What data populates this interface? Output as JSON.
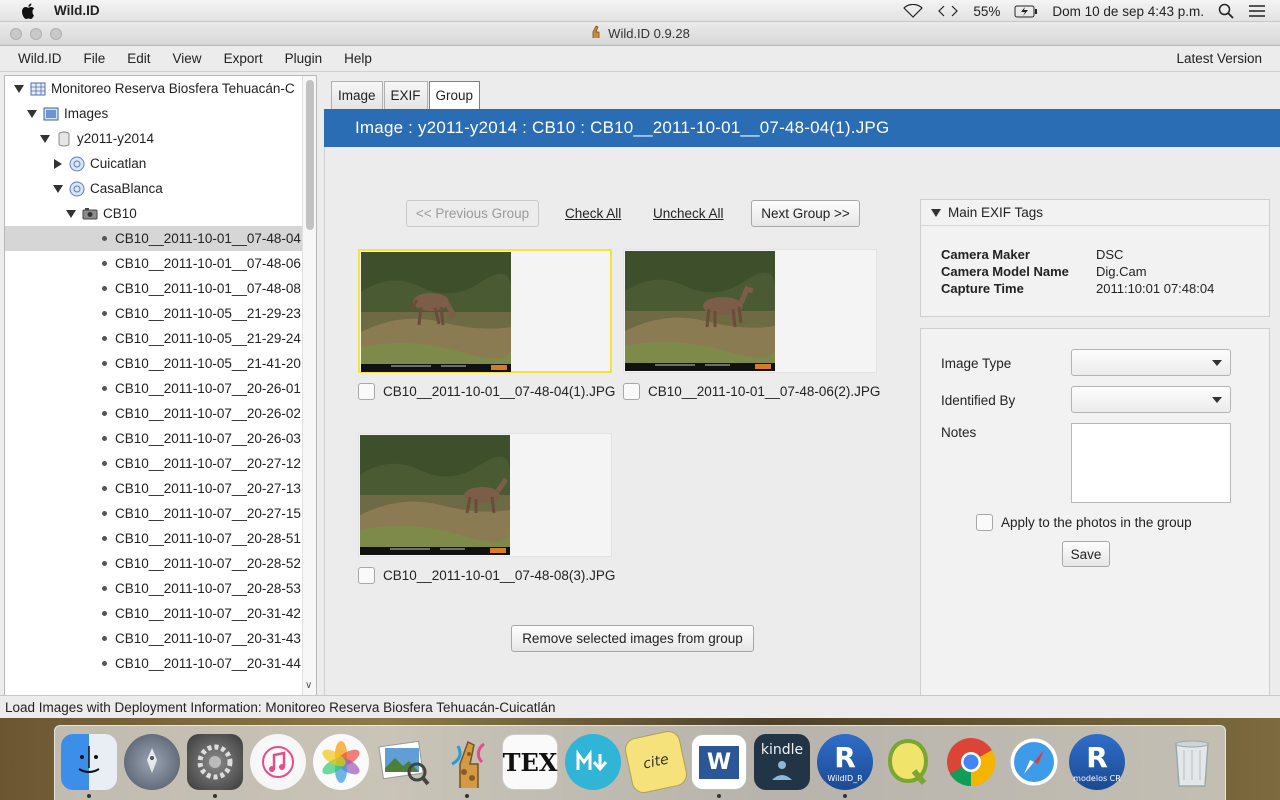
{
  "mac_menubar": {
    "app_name": "Wild.ID",
    "battery": "55%",
    "datetime": "Dom 10 de sep  4:43 p.m."
  },
  "window": {
    "title": "Wild.ID 0.9.28"
  },
  "menu": {
    "items": [
      "Wild.ID",
      "File",
      "Edit",
      "View",
      "Export",
      "Plugin",
      "Help"
    ],
    "latest_version": "Latest Version"
  },
  "tree": {
    "root": "Monitoreo Reserva Biosfera Tehuacán-C",
    "images": "Images",
    "period": "y2011-y2014",
    "site1": "Cuicatlan",
    "site2": "CasaBlanca",
    "camera": "CB10",
    "files": [
      "CB10__2011-10-01__07-48-04",
      "CB10__2011-10-01__07-48-06",
      "CB10__2011-10-01__07-48-08",
      "CB10__2011-10-05__21-29-23",
      "CB10__2011-10-05__21-29-24",
      "CB10__2011-10-05__21-41-20",
      "CB10__2011-10-07__20-26-01",
      "CB10__2011-10-07__20-26-02",
      "CB10__2011-10-07__20-26-03",
      "CB10__2011-10-07__20-27-12",
      "CB10__2011-10-07__20-27-13",
      "CB10__2011-10-07__20-27-15",
      "CB10__2011-10-07__20-28-51",
      "CB10__2011-10-07__20-28-52",
      "CB10__2011-10-07__20-28-53",
      "CB10__2011-10-07__20-31-42",
      "CB10__2011-10-07__20-31-43",
      "CB10__2011-10-07__20-31-44"
    ],
    "selected_index": 0
  },
  "tabs": [
    "Image",
    "EXIF",
    "Group"
  ],
  "active_tab": "Group",
  "header": "Image : y2011-y2014 : CB10 : CB10__2011-10-01__07-48-04(1).JPG",
  "group_controls": {
    "prev": "<< Previous Group",
    "check_all": "Check All",
    "uncheck_all": "Uncheck All",
    "next": "Next Group >>"
  },
  "group_images": [
    {
      "filename": "CB10__2011-10-01__07-48-04(1).JPG",
      "selected": true,
      "checked": false
    },
    {
      "filename": "CB10__2011-10-01__07-48-06(2).JPG",
      "selected": false,
      "checked": false
    },
    {
      "filename": "CB10__2011-10-01__07-48-08(3).JPG",
      "selected": false,
      "checked": false
    }
  ],
  "remove_button": "Remove selected images from group",
  "exif": {
    "title": "Main EXIF Tags",
    "rows": [
      {
        "key": "Camera Maker",
        "value": "DSC"
      },
      {
        "key": "Camera Model Name",
        "value": "Dig.Cam"
      },
      {
        "key": "Capture Time",
        "value": "2011:10:01 07:48:04"
      }
    ]
  },
  "form": {
    "image_type_label": "Image Type",
    "image_type_value": "",
    "identified_by_label": "Identified By",
    "identified_by_value": "",
    "notes_label": "Notes",
    "notes_value": "",
    "apply_label": "Apply to the photos in the group",
    "save": "Save"
  },
  "status": "Load Images with Deployment Information: Monitoreo Reserva Biosfera Tehuacán-Cuicatlán",
  "dock": {
    "apps": [
      "finder",
      "launchpad",
      "system-preferences",
      "itunes",
      "photos",
      "preview",
      "wildid",
      "texshop",
      "macdown",
      "citeit",
      "word",
      "kindle",
      "wildid-r",
      "qgis",
      "chrome",
      "safari",
      "modelos-r",
      "trash"
    ],
    "labels": {
      "tex": "TEX",
      "kindle": "kindle",
      "r": "R",
      "wildid_r": "WildID_R",
      "modelos_cr": "modelos CR",
      "word": "W",
      "cite": "cite"
    }
  }
}
